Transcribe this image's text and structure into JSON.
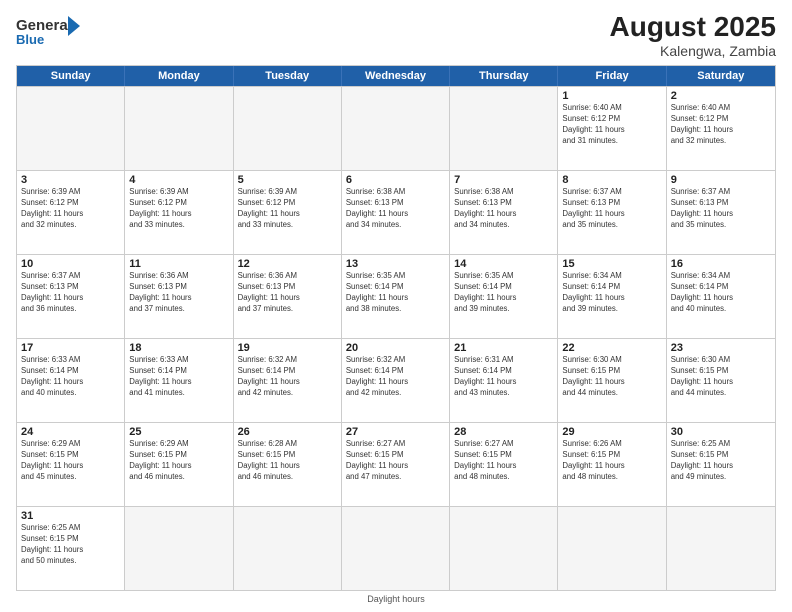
{
  "header": {
    "logo_general": "General",
    "logo_blue": "Blue",
    "month_year": "August 2025",
    "location": "Kalengwa, Zambia"
  },
  "days_of_week": [
    "Sunday",
    "Monday",
    "Tuesday",
    "Wednesday",
    "Thursday",
    "Friday",
    "Saturday"
  ],
  "footer": "Daylight hours",
  "weeks": [
    [
      {
        "day": "",
        "info": ""
      },
      {
        "day": "",
        "info": ""
      },
      {
        "day": "",
        "info": ""
      },
      {
        "day": "",
        "info": ""
      },
      {
        "day": "",
        "info": ""
      },
      {
        "day": "1",
        "info": "Sunrise: 6:40 AM\nSunset: 6:12 PM\nDaylight: 11 hours\nand 31 minutes."
      },
      {
        "day": "2",
        "info": "Sunrise: 6:40 AM\nSunset: 6:12 PM\nDaylight: 11 hours\nand 32 minutes."
      }
    ],
    [
      {
        "day": "3",
        "info": "Sunrise: 6:39 AM\nSunset: 6:12 PM\nDaylight: 11 hours\nand 32 minutes."
      },
      {
        "day": "4",
        "info": "Sunrise: 6:39 AM\nSunset: 6:12 PM\nDaylight: 11 hours\nand 33 minutes."
      },
      {
        "day": "5",
        "info": "Sunrise: 6:39 AM\nSunset: 6:12 PM\nDaylight: 11 hours\nand 33 minutes."
      },
      {
        "day": "6",
        "info": "Sunrise: 6:38 AM\nSunset: 6:13 PM\nDaylight: 11 hours\nand 34 minutes."
      },
      {
        "day": "7",
        "info": "Sunrise: 6:38 AM\nSunset: 6:13 PM\nDaylight: 11 hours\nand 34 minutes."
      },
      {
        "day": "8",
        "info": "Sunrise: 6:37 AM\nSunset: 6:13 PM\nDaylight: 11 hours\nand 35 minutes."
      },
      {
        "day": "9",
        "info": "Sunrise: 6:37 AM\nSunset: 6:13 PM\nDaylight: 11 hours\nand 35 minutes."
      }
    ],
    [
      {
        "day": "10",
        "info": "Sunrise: 6:37 AM\nSunset: 6:13 PM\nDaylight: 11 hours\nand 36 minutes."
      },
      {
        "day": "11",
        "info": "Sunrise: 6:36 AM\nSunset: 6:13 PM\nDaylight: 11 hours\nand 37 minutes."
      },
      {
        "day": "12",
        "info": "Sunrise: 6:36 AM\nSunset: 6:13 PM\nDaylight: 11 hours\nand 37 minutes."
      },
      {
        "day": "13",
        "info": "Sunrise: 6:35 AM\nSunset: 6:14 PM\nDaylight: 11 hours\nand 38 minutes."
      },
      {
        "day": "14",
        "info": "Sunrise: 6:35 AM\nSunset: 6:14 PM\nDaylight: 11 hours\nand 39 minutes."
      },
      {
        "day": "15",
        "info": "Sunrise: 6:34 AM\nSunset: 6:14 PM\nDaylight: 11 hours\nand 39 minutes."
      },
      {
        "day": "16",
        "info": "Sunrise: 6:34 AM\nSunset: 6:14 PM\nDaylight: 11 hours\nand 40 minutes."
      }
    ],
    [
      {
        "day": "17",
        "info": "Sunrise: 6:33 AM\nSunset: 6:14 PM\nDaylight: 11 hours\nand 40 minutes."
      },
      {
        "day": "18",
        "info": "Sunrise: 6:33 AM\nSunset: 6:14 PM\nDaylight: 11 hours\nand 41 minutes."
      },
      {
        "day": "19",
        "info": "Sunrise: 6:32 AM\nSunset: 6:14 PM\nDaylight: 11 hours\nand 42 minutes."
      },
      {
        "day": "20",
        "info": "Sunrise: 6:32 AM\nSunset: 6:14 PM\nDaylight: 11 hours\nand 42 minutes."
      },
      {
        "day": "21",
        "info": "Sunrise: 6:31 AM\nSunset: 6:14 PM\nDaylight: 11 hours\nand 43 minutes."
      },
      {
        "day": "22",
        "info": "Sunrise: 6:30 AM\nSunset: 6:15 PM\nDaylight: 11 hours\nand 44 minutes."
      },
      {
        "day": "23",
        "info": "Sunrise: 6:30 AM\nSunset: 6:15 PM\nDaylight: 11 hours\nand 44 minutes."
      }
    ],
    [
      {
        "day": "24",
        "info": "Sunrise: 6:29 AM\nSunset: 6:15 PM\nDaylight: 11 hours\nand 45 minutes."
      },
      {
        "day": "25",
        "info": "Sunrise: 6:29 AM\nSunset: 6:15 PM\nDaylight: 11 hours\nand 46 minutes."
      },
      {
        "day": "26",
        "info": "Sunrise: 6:28 AM\nSunset: 6:15 PM\nDaylight: 11 hours\nand 46 minutes."
      },
      {
        "day": "27",
        "info": "Sunrise: 6:27 AM\nSunset: 6:15 PM\nDaylight: 11 hours\nand 47 minutes."
      },
      {
        "day": "28",
        "info": "Sunrise: 6:27 AM\nSunset: 6:15 PM\nDaylight: 11 hours\nand 48 minutes."
      },
      {
        "day": "29",
        "info": "Sunrise: 6:26 AM\nSunset: 6:15 PM\nDaylight: 11 hours\nand 48 minutes."
      },
      {
        "day": "30",
        "info": "Sunrise: 6:25 AM\nSunset: 6:15 PM\nDaylight: 11 hours\nand 49 minutes."
      }
    ],
    [
      {
        "day": "31",
        "info": "Sunrise: 6:25 AM\nSunset: 6:15 PM\nDaylight: 11 hours\nand 50 minutes."
      },
      {
        "day": "",
        "info": ""
      },
      {
        "day": "",
        "info": ""
      },
      {
        "day": "",
        "info": ""
      },
      {
        "day": "",
        "info": ""
      },
      {
        "day": "",
        "info": ""
      },
      {
        "day": "",
        "info": ""
      }
    ]
  ]
}
